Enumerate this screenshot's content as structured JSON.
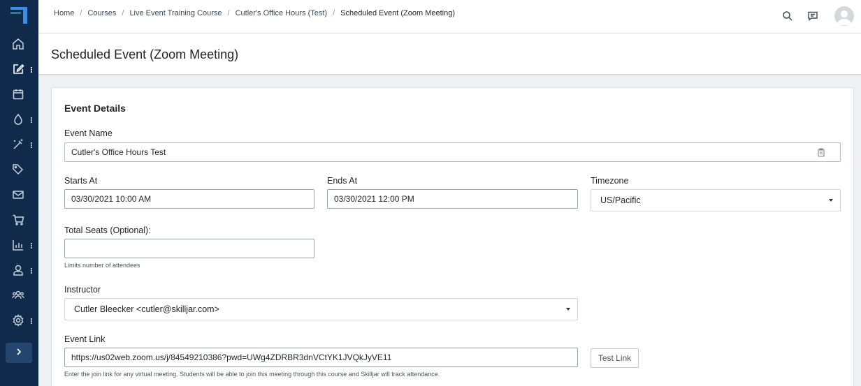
{
  "breadcrumb": {
    "items": [
      "Home",
      "Courses",
      "Live Event Training Course",
      "Cutler's Office Hours (Test)"
    ],
    "separator": "/",
    "current": "Scheduled Event (Zoom Meeting)"
  },
  "page": {
    "title": "Scheduled Event (Zoom Meeting)"
  },
  "sidebar": {
    "items": [
      {
        "icon": "home-icon"
      },
      {
        "icon": "edit-icon",
        "active": true
      },
      {
        "icon": "calendar-icon"
      },
      {
        "icon": "droplet-icon"
      },
      {
        "icon": "magic-wand-icon"
      },
      {
        "icon": "tags-icon"
      },
      {
        "icon": "mail-icon"
      },
      {
        "icon": "cart-icon"
      },
      {
        "icon": "bar-chart-icon"
      },
      {
        "icon": "user-icon"
      },
      {
        "icon": "users-icon"
      },
      {
        "icon": "gear-icon"
      }
    ],
    "expand_icon": "chevron-right-icon"
  },
  "form": {
    "section_title": "Event Details",
    "event_name": {
      "label": "Event Name",
      "value": "Cutler's Office Hours Test"
    },
    "starts_at": {
      "label": "Starts At",
      "value": "03/30/2021 10:00 AM"
    },
    "ends_at": {
      "label": "Ends At",
      "value": "03/30/2021 12:00 PM"
    },
    "timezone": {
      "label": "Timezone",
      "value": "US/Pacific"
    },
    "total_seats": {
      "label": "Total Seats (Optional):",
      "value": "",
      "help": "Limits number of attendees"
    },
    "instructor": {
      "label": "Instructor",
      "value": "Cutler Bleecker <cutler@skilljar.com>"
    },
    "event_link": {
      "label": "Event Link",
      "value": "https://us02web.zoom.us/j/84549210386?pwd=UWg4ZDRBR3dnVCtYK1JVQkJyVE11",
      "help": "Enter the join link for any virtual meeting. Students will be able to join this meeting through this course and Skilljar will track attendance.",
      "test_button": "Test Link"
    }
  },
  "colors": {
    "sidebar_bg": "#0f2a4a",
    "accent": "#3a8ee6",
    "page_bg": "#eef0f3"
  }
}
